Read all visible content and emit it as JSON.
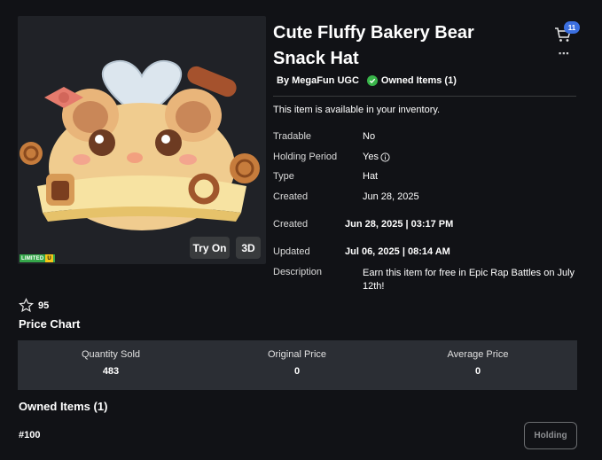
{
  "item": {
    "title": "Cute Fluffy Bakery Bear Snack Hat",
    "creator_label": "By MegaFun UGC",
    "owned_label": "Owned Items (1)",
    "availability_text": "This item is available in your inventory."
  },
  "badges": {
    "limited": "LIMITED",
    "u": "U"
  },
  "thumbnail_actions": {
    "try_on": "Try On",
    "three_d": "3D"
  },
  "header": {
    "cart_count": "11",
    "more_icon": "more-dots-icon"
  },
  "details": {
    "tradable": {
      "label": "Tradable",
      "value": "No"
    },
    "holding": {
      "label": "Holding Period",
      "value": "Yes"
    },
    "type": {
      "label": "Type",
      "value": "Hat"
    },
    "created1": {
      "label": "Created",
      "value": "Jun 28, 2025"
    },
    "created2": {
      "label": "Created",
      "value": "Jun 28, 2025 | 03:17 PM"
    },
    "updated": {
      "label": "Updated",
      "value": "Jul 06, 2025 | 08:14 AM"
    },
    "description": {
      "label": "Description",
      "value": "Earn this item for free in Epic Rap Battles on July 12th!"
    }
  },
  "favorites": {
    "count": "95"
  },
  "price_chart": {
    "title": "Price Chart",
    "stats": [
      {
        "label": "Quantity Sold",
        "value": "483"
      },
      {
        "label": "Original Price",
        "value": "0"
      },
      {
        "label": "Average Price",
        "value": "0"
      }
    ]
  },
  "owned_items": {
    "title": "Owned Items (1)",
    "serial": "#100",
    "status_button": "Holding"
  },
  "colors": {
    "background": "#111216",
    "panel": "#2b2e34",
    "accent_blue": "#3b6fe0",
    "owned_green": "#39b54a"
  }
}
